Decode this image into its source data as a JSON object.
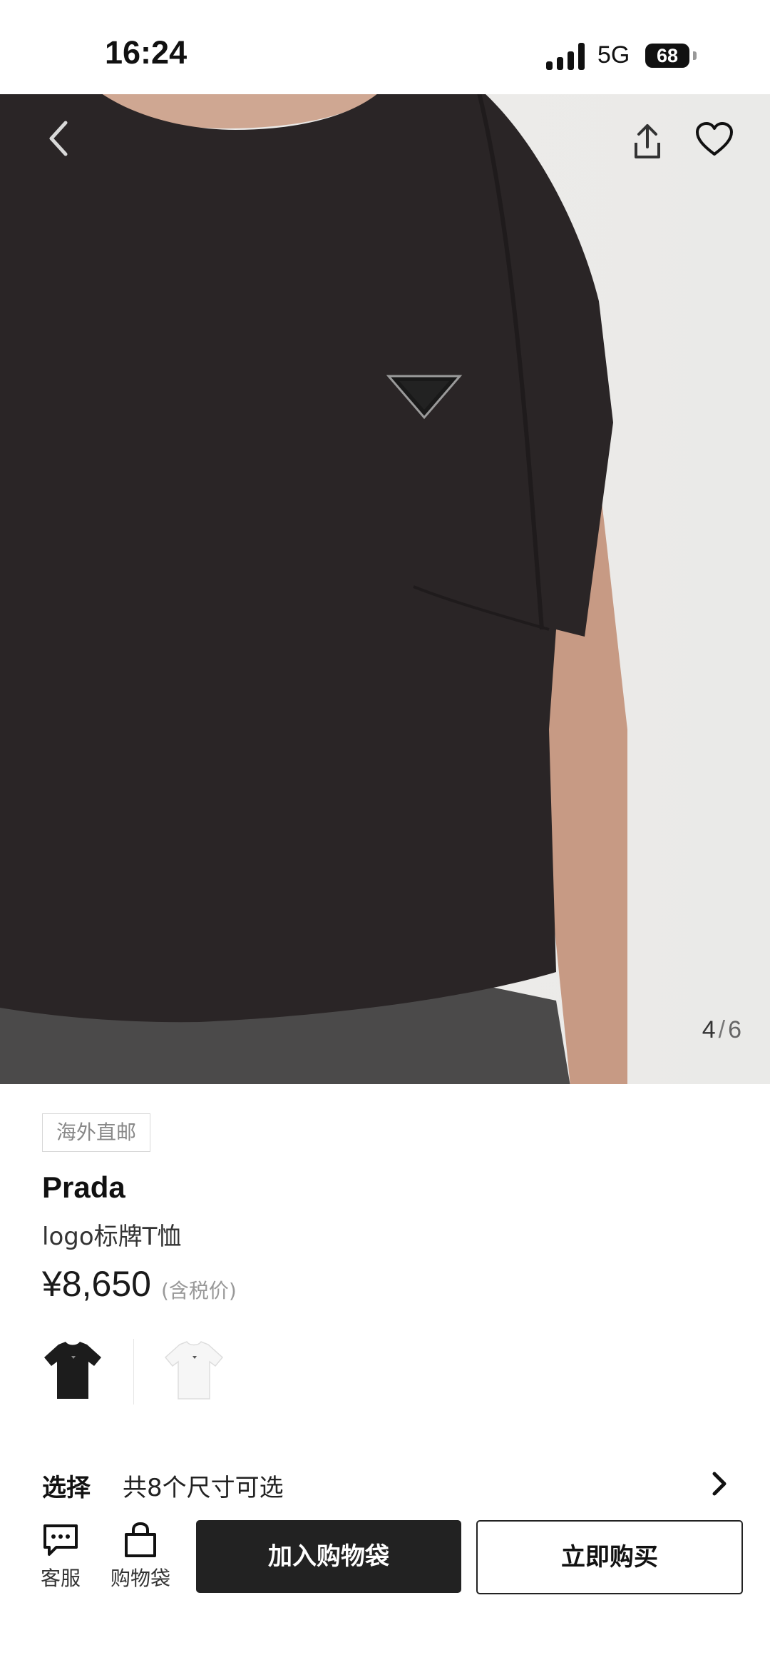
{
  "status_bar": {
    "time": "16:24",
    "network": "5G",
    "battery": "68"
  },
  "gallery": {
    "current": "4",
    "separator": "/",
    "total": "6"
  },
  "product": {
    "badge": "海外直邮",
    "brand": "Prada",
    "name": "logo标牌T恤",
    "price": "¥8,650",
    "price_note": "(含税价)",
    "colors": [
      "black",
      "white"
    ]
  },
  "size_selector": {
    "label": "选择",
    "text": "共8个尺寸可选"
  },
  "bottom_bar": {
    "service_label": "客服",
    "bag_label": "购物袋",
    "add_to_bag": "加入购物袋",
    "buy_now": "立即购买"
  },
  "icons": [
    "chevron-left-icon",
    "share-icon",
    "heart-icon",
    "chevron-right-icon",
    "chat-icon",
    "shopping-bag-icon"
  ],
  "colors": {
    "primary_button": "#222222",
    "background": "#ffffff"
  }
}
